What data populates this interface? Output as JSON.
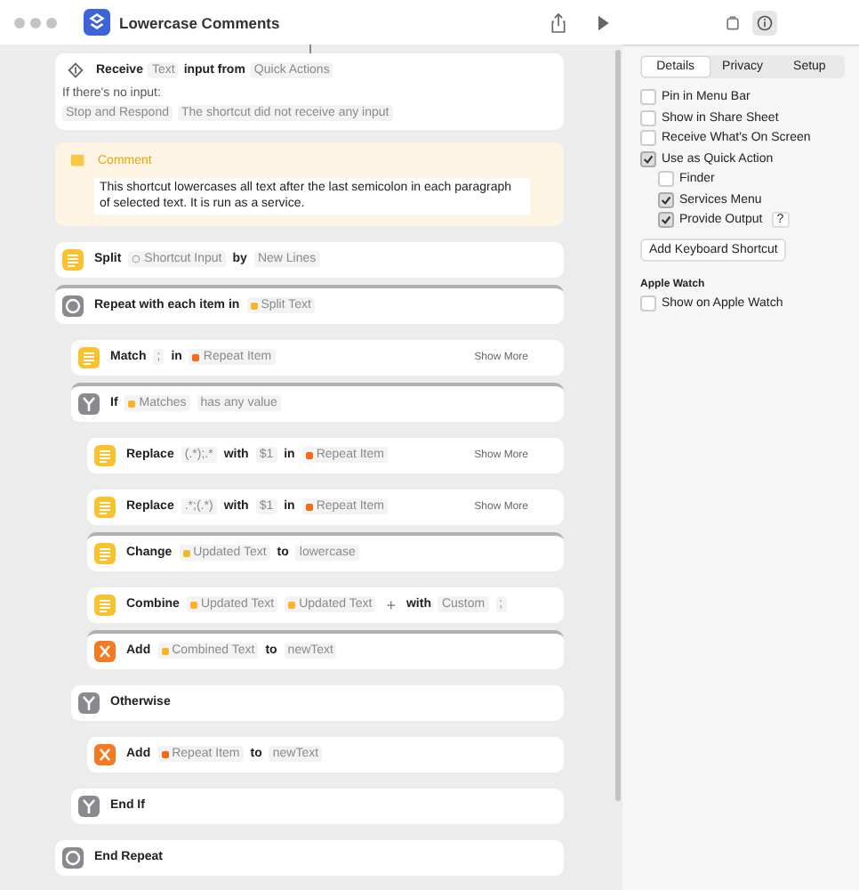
{
  "window": {
    "title": "Lowercase Comments"
  },
  "receive": {
    "tokens": [
      {
        "kind": "label",
        "text": "Receive"
      },
      {
        "kind": "param",
        "text": "Text"
      },
      {
        "kind": "label",
        "text": "input from"
      },
      {
        "kind": "param",
        "text": "Quick Actions"
      }
    ],
    "no_input_label": "If there's no input:",
    "fallback": [
      {
        "kind": "param",
        "text": "Stop and Respond"
      },
      {
        "kind": "param",
        "text": "The shortcut did not receive any input"
      }
    ]
  },
  "comment": {
    "title": "Comment",
    "text": "This shortcut lowercases all text after the last semicolon in each paragraph of selected text. It is run as a service."
  },
  "actions": [
    {
      "kind": "text",
      "connected": false,
      "tokens": [
        {
          "kind": "label",
          "text": "Split"
        },
        {
          "kind": "input",
          "text": "Shortcut Input"
        },
        {
          "kind": "label",
          "text": "by"
        },
        {
          "kind": "param",
          "text": "New Lines"
        }
      ]
    },
    {
      "kind": "repeat",
      "connected": true,
      "tokens": [
        {
          "kind": "label",
          "text": "Repeat with each item in"
        },
        {
          "kind": "var",
          "color": "#f7b52c",
          "text": "Split Text"
        }
      ],
      "children": [
        {
          "kind": "text",
          "connected": false,
          "more": "Show More",
          "tokens": [
            {
              "kind": "label",
              "text": "Match"
            },
            {
              "kind": "param",
              "text": ";"
            },
            {
              "kind": "label",
              "text": "in"
            },
            {
              "kind": "var",
              "color": "#f26b1d",
              "text": "Repeat Item"
            }
          ]
        },
        {
          "kind": "if",
          "connected": true,
          "tokens": [
            {
              "kind": "label",
              "text": "If"
            },
            {
              "kind": "var",
              "color": "#f7b52c",
              "text": "Matches"
            },
            {
              "kind": "param",
              "text": "has any value"
            }
          ],
          "children": [
            {
              "kind": "text",
              "connected": false,
              "more": "Show More",
              "tokens": [
                {
                  "kind": "label",
                  "text": "Replace"
                },
                {
                  "kind": "param",
                  "text": "(.*);.*"
                },
                {
                  "kind": "label",
                  "text": "with"
                },
                {
                  "kind": "param",
                  "text": "$1"
                },
                {
                  "kind": "label",
                  "text": "in"
                },
                {
                  "kind": "var",
                  "color": "#f26b1d",
                  "text": "Repeat Item"
                }
              ]
            },
            {
              "kind": "text",
              "connected": false,
              "more": "Show More",
              "tokens": [
                {
                  "kind": "label",
                  "text": "Replace"
                },
                {
                  "kind": "param",
                  "text": ".*;(.*)"
                },
                {
                  "kind": "label",
                  "text": "with"
                },
                {
                  "kind": "param",
                  "text": "$1"
                },
                {
                  "kind": "label",
                  "text": "in"
                },
                {
                  "kind": "var",
                  "color": "#f26b1d",
                  "text": "Repeat Item"
                }
              ]
            },
            {
              "kind": "text",
              "connected": true,
              "tokens": [
                {
                  "kind": "label",
                  "text": "Change"
                },
                {
                  "kind": "var",
                  "color": "#f7b52c",
                  "text": "Updated Text"
                },
                {
                  "kind": "label",
                  "text": "to"
                },
                {
                  "kind": "param",
                  "text": "lowercase"
                }
              ]
            },
            {
              "kind": "text",
              "connected": false,
              "tokens": [
                {
                  "kind": "label",
                  "text": "Combine"
                },
                {
                  "kind": "var",
                  "color": "#f7b52c",
                  "text": "Updated Text"
                },
                {
                  "kind": "var",
                  "color": "#f7b52c",
                  "text": "Updated Text"
                },
                {
                  "kind": "plain",
                  "text": "+"
                },
                {
                  "kind": "label",
                  "text": "with"
                },
                {
                  "kind": "param",
                  "text": "Custom"
                },
                {
                  "kind": "param",
                  "text": ";"
                }
              ]
            },
            {
              "kind": "variable",
              "connected": true,
              "tokens": [
                {
                  "kind": "label",
                  "text": "Add"
                },
                {
                  "kind": "var",
                  "color": "#f7b52c",
                  "text": "Combined Text"
                },
                {
                  "kind": "label",
                  "text": "to"
                },
                {
                  "kind": "param",
                  "text": "newText"
                }
              ]
            }
          ]
        },
        {
          "kind": "if",
          "connected": false,
          "tokens": [
            {
              "kind": "label",
              "text": "Otherwise"
            }
          ],
          "children": [
            {
              "kind": "variable",
              "connected": false,
              "tokens": [
                {
                  "kind": "label",
                  "text": "Add"
                },
                {
                  "kind": "var",
                  "color": "#f26b1d",
                  "text": "Repeat Item"
                },
                {
                  "kind": "label",
                  "text": "to"
                },
                {
                  "kind": "param",
                  "text": "newText"
                }
              ]
            }
          ]
        },
        {
          "kind": "if",
          "connected": false,
          "tokens": [
            {
              "kind": "label",
              "text": "End If"
            }
          ]
        }
      ]
    },
    {
      "kind": "repeat",
      "connected": false,
      "tokens": [
        {
          "kind": "label",
          "text": "End Repeat"
        }
      ]
    }
  ],
  "inspector": {
    "toolbar": [
      {
        "kind": "library",
        "selected": false
      },
      {
        "kind": "info",
        "selected": true
      }
    ],
    "tabs": [
      {
        "label": "Details",
        "selected": true
      },
      {
        "label": "Privacy",
        "selected": false
      },
      {
        "label": "Setup",
        "selected": false
      }
    ],
    "options": [
      {
        "label": "Pin in Menu Bar",
        "checked": false
      },
      {
        "label": "Show in Share Sheet",
        "checked": false
      },
      {
        "label": "Receive What's On Screen",
        "checked": false
      },
      {
        "label": "Use as Quick Action",
        "checked": true,
        "children": [
          {
            "label": "Finder",
            "checked": false
          },
          {
            "label": "Services Menu",
            "checked": true
          },
          {
            "label": "Provide Output",
            "checked": true,
            "help": "?"
          }
        ]
      }
    ],
    "button": "Add Keyboard Shortcut",
    "sections": [
      {
        "title": "Apple Watch",
        "options": [
          {
            "label": "Show on Apple Watch",
            "checked": false
          }
        ]
      }
    ]
  }
}
